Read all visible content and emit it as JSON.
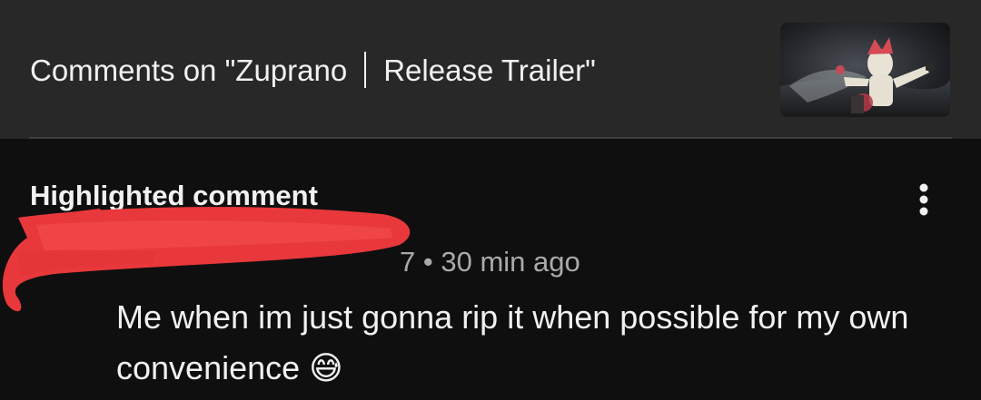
{
  "header": {
    "title_prefix": "Comments on \"Zuprano",
    "title_suffix": "Release Trailer\""
  },
  "comment": {
    "highlight_label": "Highlighted comment",
    "handle_visible_fragment": "7",
    "meta_separator": "•",
    "time_ago": "30 min ago",
    "text": "Me when im just gonna rip it when possible for my own convenience 😅"
  },
  "colors": {
    "background": "#0f0f0f",
    "header_background": "#282828",
    "primary_text": "#f1f1f1",
    "secondary_text": "#aaaaaa",
    "redaction": "#e8383b"
  },
  "icons": {
    "menu": "more-vertical-icon"
  }
}
